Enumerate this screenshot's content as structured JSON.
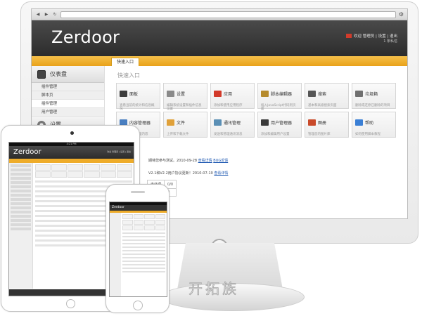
{
  "browser": {
    "url": ""
  },
  "header": {
    "logo": "Zerdoor",
    "links": "欢迎 管理员 | 设置 | 退出",
    "unread": "1 条私信"
  },
  "tabs": [
    {
      "label": "快速入口"
    }
  ],
  "sidebar": {
    "dashboard_label": "仪表盘",
    "items": [
      {
        "label": "插件管理"
      },
      {
        "label": "脚本页"
      },
      {
        "label": "插件管理"
      },
      {
        "label": "用户管理"
      }
    ],
    "settings_label": "设置"
  },
  "main": {
    "section_title": "快速入口",
    "tiles": [
      {
        "title": "面板",
        "desc": "查看当前的统计和信息概况",
        "icon": "panel-icon",
        "color": "#3c3c3c"
      },
      {
        "title": "设置",
        "desc": "编辑系统设置和插件信息设置",
        "icon": "settings-icon",
        "color": "#8a8a8a"
      },
      {
        "title": "应用",
        "desc": "添加和使用应用程序",
        "icon": "apps-icon",
        "color": "#d23a2a"
      },
      {
        "title": "脚本编辑器",
        "desc": "插入JavaScript代码到页面",
        "icon": "script-editor-icon",
        "color": "#b58a2c"
      },
      {
        "title": "搜索",
        "desc": "基本和高级搜索页面",
        "icon": "search-icon",
        "color": "#555555"
      },
      {
        "title": "垃圾箱",
        "desc": "删除或还原已删除的项目",
        "icon": "trash-icon",
        "color": "#6f6f6f"
      },
      {
        "title": "内容管理器",
        "desc": "添加编辑和管理内容",
        "icon": "content-manager-icon",
        "color": "#4a7fc1"
      },
      {
        "title": "文件",
        "desc": "上传和下载文件",
        "icon": "file-icon",
        "color": "#e0a13a"
      },
      {
        "title": "通讯管理",
        "desc": "发送和管理通讯消息",
        "icon": "mail-icon",
        "color": "#5a8fb5"
      },
      {
        "title": "用户管理器",
        "desc": "添加和编辑用户设置",
        "icon": "users-icon",
        "color": "#3a3a3a"
      },
      {
        "title": "图册",
        "desc": "管理您的图片库",
        "icon": "gallery-icon",
        "color": "#c94a2a"
      },
      {
        "title": "帮助",
        "desc": "如何使用脚本教程",
        "icon": "help-icon",
        "color": "#3a7fd5"
      }
    ],
    "news": [
      {
        "text": "期待您参与测试。2010-09-28",
        "link1": "查看详情",
        "link2": "BUG反馈"
      },
      {
        "text": "V2.1和V2.2用户协议更新！2010-07-10",
        "link1": "查看详情"
      }
    ],
    "table": {
      "label": "未处理",
      "value": "0/0",
      "count": "0"
    }
  },
  "tablet": {
    "logo": "Zerdoor",
    "status": "4:21 PM"
  },
  "phone": {
    "logo": "Zerdoor",
    "status": "4:21 PM"
  },
  "watermark": "开拓族"
}
